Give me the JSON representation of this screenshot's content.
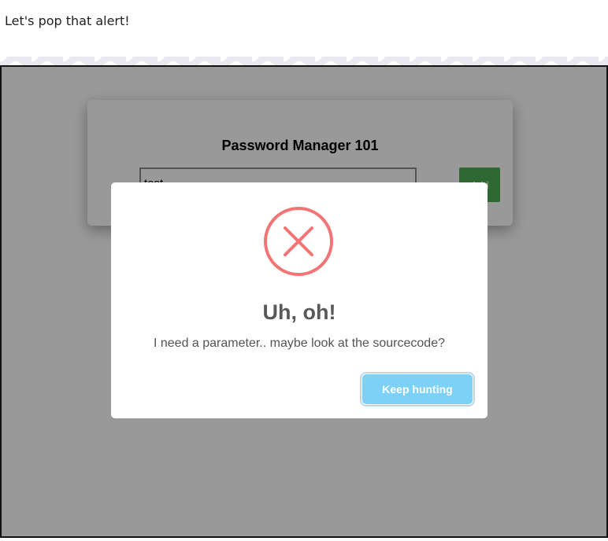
{
  "page": {
    "top_text": "Let's pop that alert!"
  },
  "app": {
    "title": "Password Manager 101",
    "input_value": "test",
    "add_label": "Add"
  },
  "modal": {
    "icon": "error-x-icon",
    "title": "Uh, oh!",
    "text": "I need a parameter.. maybe look at the sourcecode?",
    "button_label": "Keep hunting"
  },
  "colors": {
    "overlay": "rgba(0,0,0,0.4)",
    "error_red": "#f27474",
    "confirm_blue": "#7cd1f9",
    "add_green": "#4caf50"
  }
}
